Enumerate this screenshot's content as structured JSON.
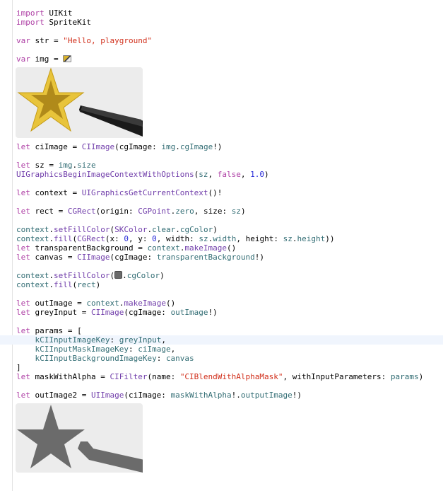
{
  "colors": {
    "keyword": "#ad3da4",
    "string": "#d12f1b",
    "number": "#272ad8",
    "type": "#703daa",
    "identifier": "#326d74",
    "plain": "#000000",
    "current_line": "#f0f5fd",
    "preview_background": "#ececec",
    "star_gold": "#e8c43b",
    "star_dark_gold": "#b08a1a",
    "wand_black": "#333333",
    "result_grey": "#6b6b6b"
  },
  "inline_icons": {
    "image_literal": "image-thumbnail-icon",
    "color_literal": "grey-color-swatch-icon"
  },
  "previews": {
    "first": "star-wand-gold-image",
    "second": "star-wand-grey-image"
  },
  "code": {
    "l1": [
      [
        "kw",
        "import"
      ],
      [
        "p",
        " UIKit"
      ]
    ],
    "l2": [
      [
        "kw",
        "import"
      ],
      [
        "p",
        " SpriteKit"
      ]
    ],
    "l4": [
      [
        "kw",
        "var"
      ],
      [
        "p",
        " str = "
      ],
      [
        "str",
        "\"Hello, playground\""
      ]
    ],
    "l6": [
      [
        "kw",
        "var"
      ],
      [
        "p",
        " img = "
      ]
    ],
    "l8": [
      [
        "kw",
        "let"
      ],
      [
        "p",
        " ciImage = "
      ],
      [
        "ty",
        "CIImage"
      ],
      [
        "p",
        "(cgImage: "
      ],
      [
        "id",
        "img"
      ],
      [
        "p",
        "."
      ],
      [
        "id",
        "cgImage"
      ],
      [
        "p",
        "!)"
      ]
    ],
    "l10": [
      [
        "kw",
        "let"
      ],
      [
        "p",
        " sz = "
      ],
      [
        "id",
        "img"
      ],
      [
        "p",
        "."
      ],
      [
        "id",
        "size"
      ]
    ],
    "l11": [
      [
        "ty",
        "UIGraphicsBeginImageContextWithOptions"
      ],
      [
        "p",
        "("
      ],
      [
        "id",
        "sz"
      ],
      [
        "p",
        ", "
      ],
      [
        "kw",
        "false"
      ],
      [
        "p",
        ", "
      ],
      [
        "num",
        "1.0"
      ],
      [
        "p",
        ")"
      ]
    ],
    "l13": [
      [
        "kw",
        "let"
      ],
      [
        "p",
        " context = "
      ],
      [
        "ty",
        "UIGraphicsGetCurrentContext"
      ],
      [
        "p",
        "()!"
      ]
    ],
    "l15": [
      [
        "kw",
        "let"
      ],
      [
        "p",
        " rect = "
      ],
      [
        "ty",
        "CGRect"
      ],
      [
        "p",
        "(origin: "
      ],
      [
        "ty",
        "CGPoint"
      ],
      [
        "p",
        "."
      ],
      [
        "id",
        "zero"
      ],
      [
        "p",
        ", size: "
      ],
      [
        "id",
        "sz"
      ],
      [
        "p",
        ")"
      ]
    ],
    "l17": [
      [
        "id",
        "context"
      ],
      [
        "p",
        "."
      ],
      [
        "ty",
        "setFillColor"
      ],
      [
        "p",
        "("
      ],
      [
        "ty",
        "SKColor"
      ],
      [
        "p",
        "."
      ],
      [
        "id",
        "clear"
      ],
      [
        "p",
        "."
      ],
      [
        "id",
        "cgColor"
      ],
      [
        "p",
        ")"
      ]
    ],
    "l18": [
      [
        "id",
        "context"
      ],
      [
        "p",
        "."
      ],
      [
        "ty",
        "fill"
      ],
      [
        "p",
        "("
      ],
      [
        "ty",
        "CGRect"
      ],
      [
        "p",
        "(x: "
      ],
      [
        "num",
        "0"
      ],
      [
        "p",
        ", y: "
      ],
      [
        "num",
        "0"
      ],
      [
        "p",
        ", width: "
      ],
      [
        "id",
        "sz"
      ],
      [
        "p",
        "."
      ],
      [
        "id",
        "width"
      ],
      [
        "p",
        ", height: "
      ],
      [
        "id",
        "sz"
      ],
      [
        "p",
        "."
      ],
      [
        "id",
        "height"
      ],
      [
        "p",
        "))"
      ]
    ],
    "l19": [
      [
        "kw",
        "let"
      ],
      [
        "p",
        " transparentBackground = "
      ],
      [
        "id",
        "context"
      ],
      [
        "p",
        "."
      ],
      [
        "ty",
        "makeImage"
      ],
      [
        "p",
        "()"
      ]
    ],
    "l20": [
      [
        "kw",
        "let"
      ],
      [
        "p",
        " canvas = "
      ],
      [
        "ty",
        "CIImage"
      ],
      [
        "p",
        "(cgImage: "
      ],
      [
        "id",
        "transparentBackground"
      ],
      [
        "p",
        "!)"
      ]
    ],
    "l22a": [
      [
        "id",
        "context"
      ],
      [
        "p",
        "."
      ],
      [
        "ty",
        "setFillColor"
      ],
      [
        "p",
        "("
      ]
    ],
    "l22b": [
      [
        "p",
        "."
      ],
      [
        "id",
        "cgColor"
      ],
      [
        "p",
        ")"
      ]
    ],
    "l23": [
      [
        "id",
        "context"
      ],
      [
        "p",
        "."
      ],
      [
        "ty",
        "fill"
      ],
      [
        "p",
        "("
      ],
      [
        "id",
        "rect"
      ],
      [
        "p",
        ")"
      ]
    ],
    "l25": [
      [
        "kw",
        "let"
      ],
      [
        "p",
        " outImage = "
      ],
      [
        "id",
        "context"
      ],
      [
        "p",
        "."
      ],
      [
        "ty",
        "makeImage"
      ],
      [
        "p",
        "()"
      ]
    ],
    "l26": [
      [
        "kw",
        "let"
      ],
      [
        "p",
        " greyInput = "
      ],
      [
        "ty",
        "CIImage"
      ],
      [
        "p",
        "(cgImage: "
      ],
      [
        "id",
        "outImage"
      ],
      [
        "p",
        "!)"
      ]
    ],
    "l28": [
      [
        "kw",
        "let"
      ],
      [
        "p",
        " params = ["
      ]
    ],
    "l29": [
      [
        "p",
        "    "
      ],
      [
        "id",
        "kCIInputImageKey"
      ],
      [
        "p",
        ": "
      ],
      [
        "id",
        "greyInput"
      ],
      [
        "p",
        ","
      ]
    ],
    "l30": [
      [
        "p",
        "    "
      ],
      [
        "id",
        "kCIInputMaskImageKey"
      ],
      [
        "p",
        ": "
      ],
      [
        "id",
        "ciImage"
      ],
      [
        "p",
        ","
      ]
    ],
    "l31": [
      [
        "p",
        "    "
      ],
      [
        "id",
        "kCIInputBackgroundImageKey"
      ],
      [
        "p",
        ": "
      ],
      [
        "id",
        "canvas"
      ]
    ],
    "l32": [
      [
        "p",
        "]"
      ]
    ],
    "l33": [
      [
        "kw",
        "let"
      ],
      [
        "p",
        " maskWithAlpha = "
      ],
      [
        "ty",
        "CIFilter"
      ],
      [
        "p",
        "(name: "
      ],
      [
        "str",
        "\"CIBlendWithAlphaMask\""
      ],
      [
        "p",
        ", withInputParameters: "
      ],
      [
        "id",
        "params"
      ],
      [
        "p",
        ")"
      ]
    ],
    "l35": [
      [
        "kw",
        "let"
      ],
      [
        "p",
        " outImage2 = "
      ],
      [
        "ty",
        "UIImage"
      ],
      [
        "p",
        "(ciImage: "
      ],
      [
        "id",
        "maskWithAlpha"
      ],
      [
        "p",
        "!."
      ],
      [
        "id",
        "outputImage"
      ],
      [
        "p",
        "!)"
      ]
    ]
  }
}
